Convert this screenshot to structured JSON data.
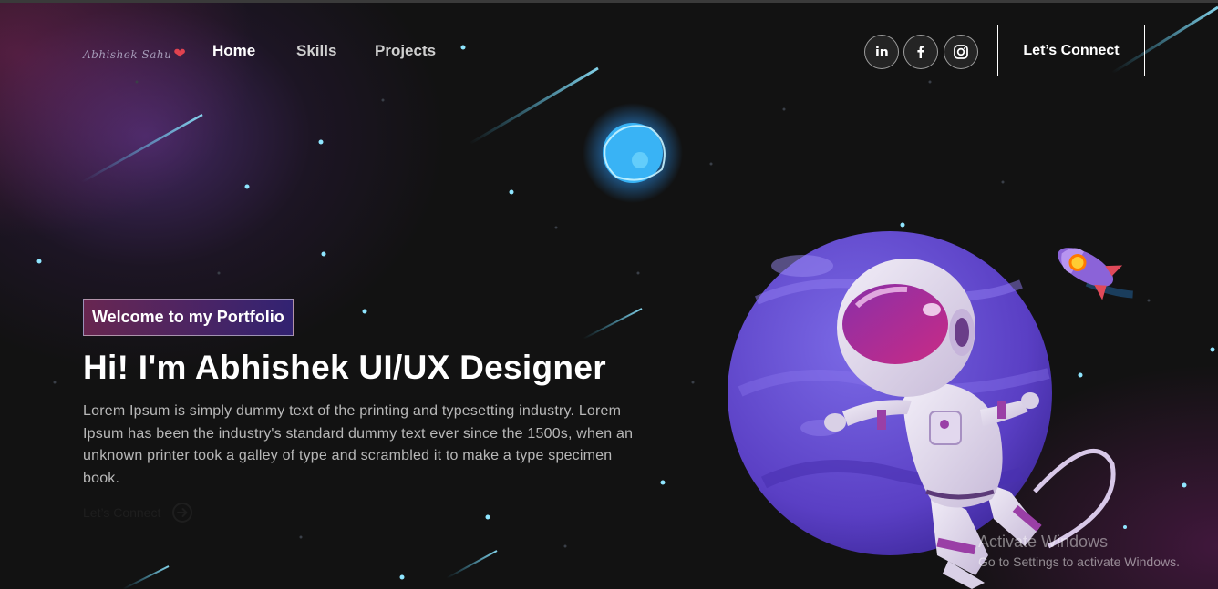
{
  "nav": {
    "logo": "Abhishek Sahu",
    "logo_heart": "❤",
    "links": [
      {
        "label": "Home",
        "active": true
      },
      {
        "label": "Skills",
        "active": false
      },
      {
        "label": "Projects",
        "active": false
      }
    ],
    "social_icons": [
      "linkedin-icon",
      "facebook-icon",
      "instagram-icon"
    ],
    "cta_label": "Let’s Connect"
  },
  "hero": {
    "tagline": "Welcome to my Portfolio",
    "headline": "Hi! I'm Abhishek UI/UX Designer",
    "description": "Lorem Ipsum is simply dummy text of the printing and typesetting industry. Lorem Ipsum has been the industry's standard dummy text ever since the 1500s, when an unknown printer took a galley of type and scrambled it to make a type specimen book.",
    "connect_label": "Let’s Connect"
  },
  "illustration": {
    "subjects": [
      "astronaut",
      "purple-planet",
      "blue-planet",
      "rocket",
      "shooting-stars",
      "stars"
    ]
  },
  "watermark": {
    "title": "Activate Windows",
    "subtitle": "Go to Settings to activate Windows."
  },
  "colors": {
    "background": "#121212",
    "accent_purple": "#6a4fd0",
    "accent_pink": "#aa367c",
    "text_muted": "#b8b8b8"
  }
}
